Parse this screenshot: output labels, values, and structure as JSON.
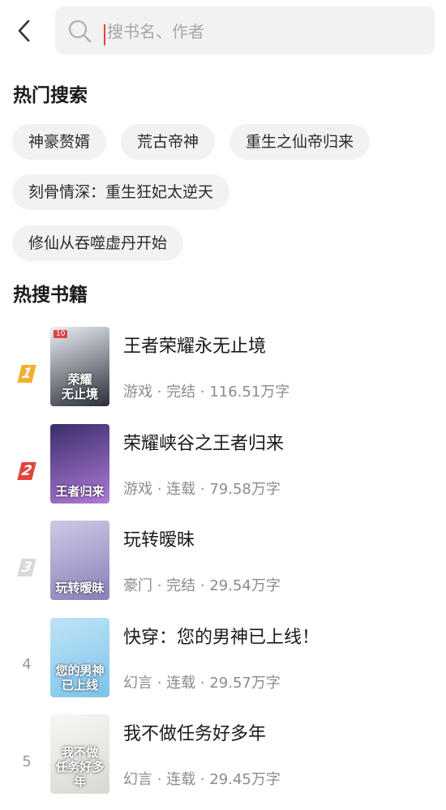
{
  "search": {
    "placeholder": "搜书名、作者"
  },
  "hot_search": {
    "title": "热门搜索",
    "tags": [
      "神豪赘婿",
      "荒古帝神",
      "重生之仙帝归来",
      "刻骨情深：重生狂妃太逆天",
      "修仙从吞噬虚丹开始"
    ]
  },
  "hot_books": {
    "title": "热搜书籍",
    "items": [
      {
        "rank": "1",
        "rank_color": "#f0b030",
        "title": "王者荣耀永无止境",
        "meta": "游戏 · 完结 · 116.51万字",
        "cover_text": "荣耀\n无止境",
        "cover_tag": "10",
        "cover_colors": [
          "#e9eef3",
          "#2b2f3a"
        ]
      },
      {
        "rank": "2",
        "rank_color": "#e0453b",
        "title": "荣耀峡谷之王者归来",
        "meta": "游戏 · 连载 · 79.58万字",
        "cover_text": "王者归来",
        "cover_tag": "",
        "cover_colors": [
          "#3a2f6b",
          "#b07ad8"
        ]
      },
      {
        "rank": "3",
        "rank_color": "#d9d9d9",
        "title": "玩转暧昧",
        "meta": "豪门 · 完结 · 29.54万字",
        "cover_text": "玩转暧昧",
        "cover_tag": "",
        "cover_colors": [
          "#cfc9e6",
          "#8a7fb8"
        ]
      },
      {
        "rank": "4",
        "rank_color": "",
        "title": "快穿：您的男神已上线！",
        "meta": "幻言 · 连载 · 29.57万字",
        "cover_text": "您的男神\n已上线",
        "cover_tag": "",
        "cover_colors": [
          "#bfe3f7",
          "#7cc4ea"
        ]
      },
      {
        "rank": "5",
        "rank_color": "",
        "title": "我不做任务好多年",
        "meta": "幻言 · 连载 · 29.45万字",
        "cover_text": "我不做\n任务好多年",
        "cover_tag": "",
        "cover_colors": [
          "#f7f7f5",
          "#d8d8d2"
        ]
      }
    ]
  }
}
